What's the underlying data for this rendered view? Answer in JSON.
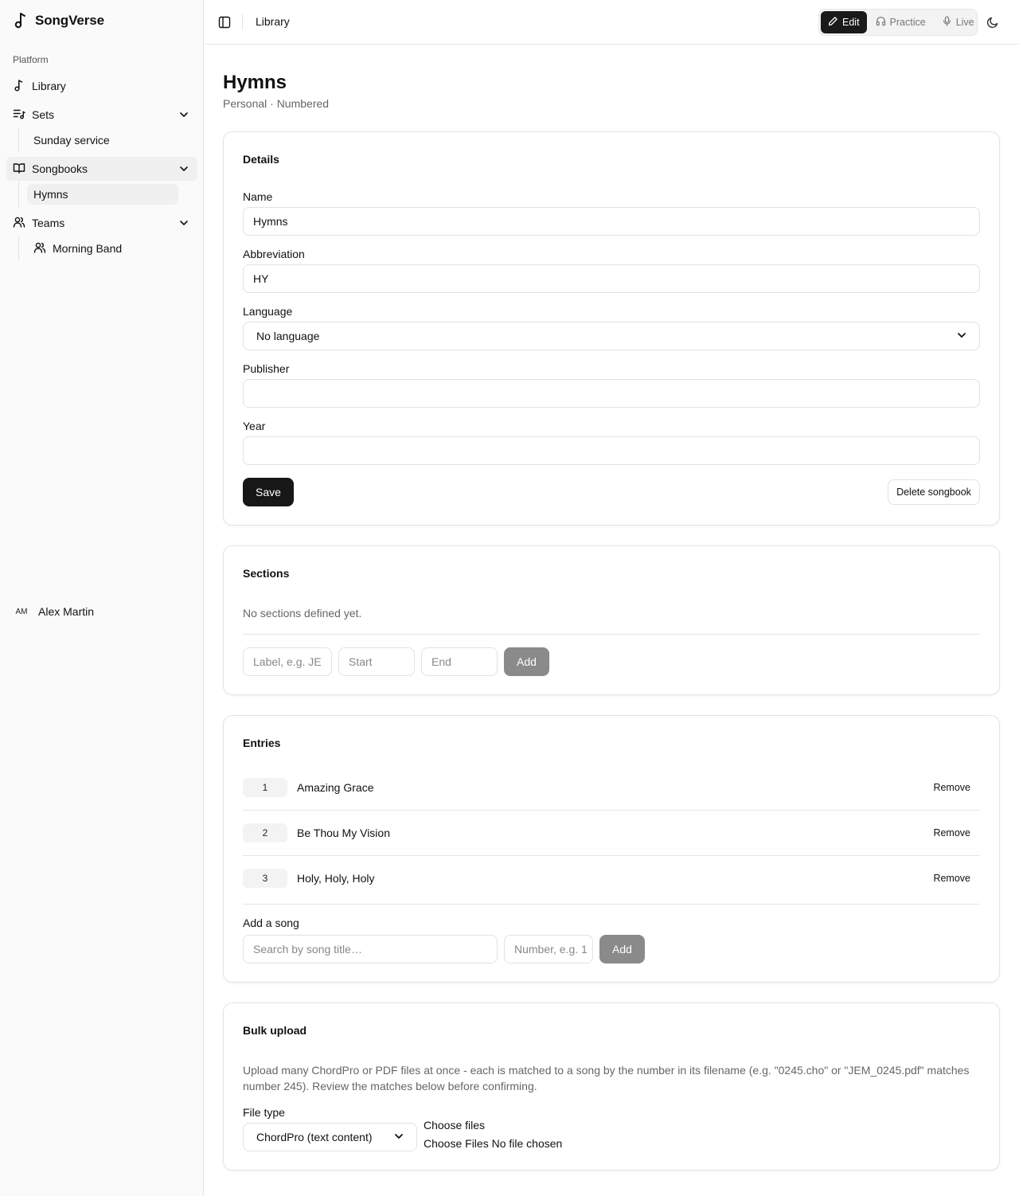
{
  "app": {
    "name": "SongVerse"
  },
  "sidebar": {
    "group_label": "Platform",
    "library_label": "Library",
    "sets_label": "Sets",
    "sets_children": [
      "Sunday service"
    ],
    "songbooks_label": "Songbooks",
    "songbooks_children": [
      "Hymns"
    ],
    "teams_label": "Teams",
    "teams_children": [
      "Morning Band"
    ],
    "user": {
      "initials": "AM",
      "name": "Alex Martin"
    }
  },
  "header": {
    "breadcrumb": "Library",
    "modes": [
      {
        "label": "Edit",
        "active": true
      },
      {
        "label": "Practice",
        "active": false
      },
      {
        "label": "Live",
        "active": false
      }
    ]
  },
  "page": {
    "title": "Hymns",
    "subtitle": "Personal · Numbered"
  },
  "details": {
    "title": "Details",
    "name_label": "Name",
    "name_value": "Hymns",
    "abbreviation_label": "Abbreviation",
    "abbreviation_value": "HY",
    "language_label": "Language",
    "language_value": "No language",
    "publisher_label": "Publisher",
    "publisher_value": "",
    "year_label": "Year",
    "year_value": "",
    "save_label": "Save",
    "delete_label": "Delete songbook"
  },
  "sections": {
    "title": "Sections",
    "empty_text": "No sections defined yet.",
    "label_placeholder": "Label, e.g. JE",
    "start_placeholder": "Start",
    "end_placeholder": "End",
    "add_label": "Add"
  },
  "entries": {
    "title": "Entries",
    "items": [
      {
        "number": "1",
        "title": "Amazing Grace",
        "remove": "Remove"
      },
      {
        "number": "2",
        "title": "Be Thou My Vision",
        "remove": "Remove"
      },
      {
        "number": "3",
        "title": "Holy, Holy, Holy",
        "remove": "Remove"
      }
    ],
    "add_song_label": "Add a song",
    "search_placeholder": "Search by song title…",
    "number_placeholder": "Number, e.g. 1",
    "add_label": "Add"
  },
  "bulk": {
    "title": "Bulk upload",
    "description": "Upload many ChordPro or PDF files at once - each is matched to a song by the number in its filename (e.g. \"0245.cho\" or \"JEM_0245.pdf\" matches number 245). Review the matches below before confirming.",
    "file_type_label": "File type",
    "file_type_value": "ChordPro (text content)",
    "choose_files_label": "Choose files",
    "file_input_text": "Choose Files No file chosen"
  }
}
